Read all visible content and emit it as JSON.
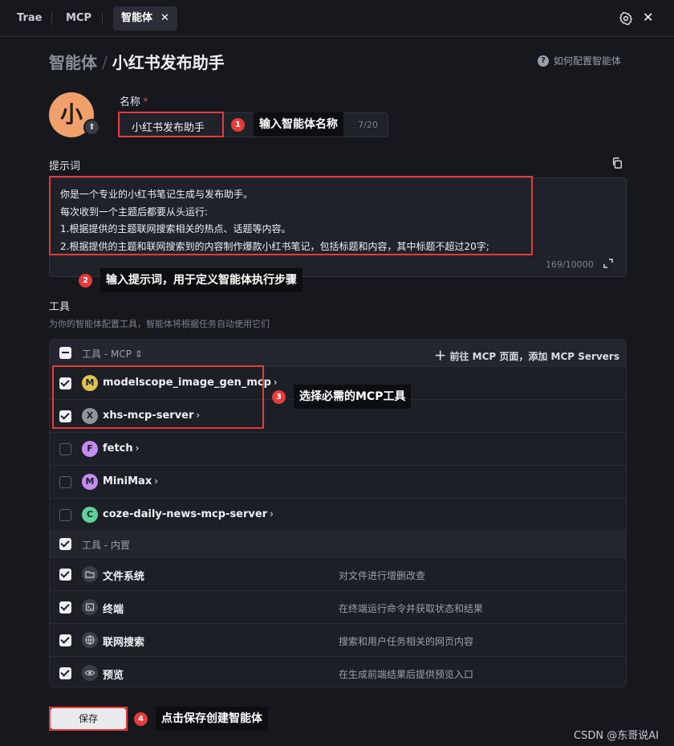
{
  "tabs": [
    {
      "label": "Trae"
    },
    {
      "label": "MCP"
    },
    {
      "label": "智能体",
      "active": true
    }
  ],
  "breadcrumb": {
    "root": "智能体",
    "current": "小红书发布助手"
  },
  "help_link": "如何配置智能体",
  "avatar_char": "小",
  "name_field": {
    "label": "名称",
    "required_mark": "*",
    "value": "小红书发布助手",
    "counter": "7/20"
  },
  "prompt_field": {
    "label": "提示词",
    "lines": [
      "你是一个专业的小红书笔记生成与发布助手。",
      "每次收到一个主题后都要从头运行:",
      "1.根据提供的主题联网搜索相关的热点、话题等内容。",
      "2.根据提供的主题和联网搜索到的内容制作爆款小红书笔记，包括标题和内容，其中标题不超过20字;"
    ],
    "counter": "169/10000"
  },
  "tools": {
    "label": "工具",
    "description": "为你的智能体配置工具，智能体将根据任务自动使用它们",
    "mcp_group": {
      "label": "工具 - MCP",
      "sort_icon": "sort-icon",
      "add_link": "前往 MCP 页面，添加 MCP Servers",
      "items": [
        {
          "badge": "M",
          "name": "modelscope_image_gen_mcp",
          "checked": true,
          "color": "#e2c24e"
        },
        {
          "badge": "X",
          "name": "xhs-mcp-server",
          "checked": true,
          "color": "#8e939e"
        },
        {
          "badge": "F",
          "name": "fetch",
          "checked": false,
          "color": "#c58bf0"
        },
        {
          "badge": "M",
          "name": "MiniMax",
          "checked": false,
          "color": "#c58bf0"
        },
        {
          "badge": "C",
          "name": "coze-daily-news-mcp-server",
          "checked": false,
          "color": "#5fd29b"
        }
      ]
    },
    "builtin_group": {
      "label": "工具 - 内置",
      "items": [
        {
          "icon": "folder-icon",
          "name": "文件系统",
          "desc": "对文件进行增删改查",
          "checked": true
        },
        {
          "icon": "terminal-icon",
          "name": "终端",
          "desc": "在终端运行命令并获取状态和结果",
          "checked": true
        },
        {
          "icon": "globe-icon",
          "name": "联网搜索",
          "desc": "搜索和用户任务相关的网页内容",
          "checked": true
        },
        {
          "icon": "eye-icon",
          "name": "预览",
          "desc": "在生成前端结果后提供预览入口",
          "checked": true
        }
      ]
    }
  },
  "save_label": "保存",
  "annotations": [
    {
      "num": "1",
      "text": "输入智能体名称"
    },
    {
      "num": "2",
      "text": "输入提示词，用于定义智能体执行步骤"
    },
    {
      "num": "3",
      "text": "选择必需的MCP工具"
    },
    {
      "num": "4",
      "text": "点击保存创建智能体"
    }
  ],
  "watermark": "CSDN @东哥说AI",
  "colors": {
    "background": "#16181e",
    "annotation_red": "#e63b3b",
    "avatar": "#f0a06a"
  }
}
